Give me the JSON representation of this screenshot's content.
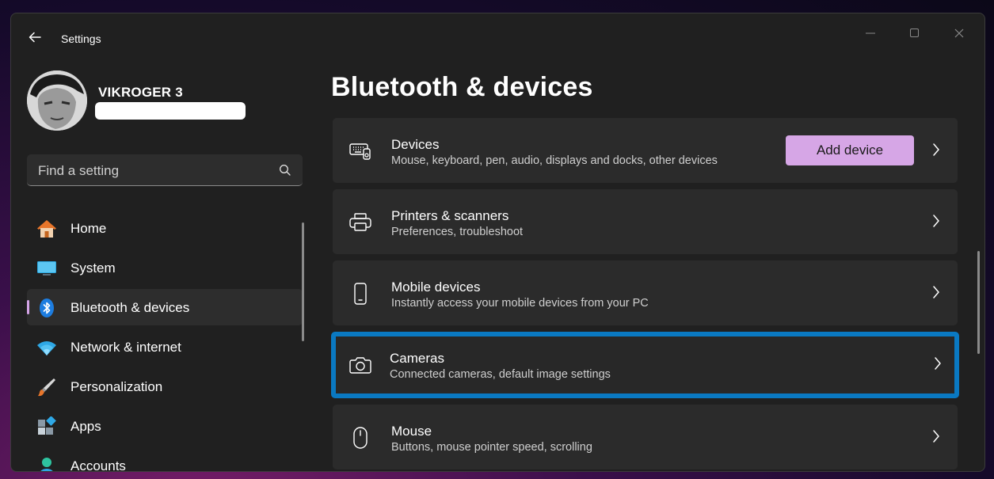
{
  "window": {
    "title": "Settings"
  },
  "profile": {
    "name": "VIKROGER 3"
  },
  "search": {
    "placeholder": "Find a setting"
  },
  "nav": {
    "items": [
      {
        "label": "Home",
        "icon": "home-icon"
      },
      {
        "label": "System",
        "icon": "system-icon"
      },
      {
        "label": "Bluetooth & devices",
        "icon": "bluetooth-icon",
        "active": true
      },
      {
        "label": "Network & internet",
        "icon": "wifi-icon"
      },
      {
        "label": "Personalization",
        "icon": "brush-icon"
      },
      {
        "label": "Apps",
        "icon": "apps-icon"
      },
      {
        "label": "Accounts",
        "icon": "accounts-icon"
      }
    ]
  },
  "page": {
    "title": "Bluetooth & devices"
  },
  "cards": [
    {
      "title": "Devices",
      "subtitle": "Mouse, keyboard, pen, audio, displays and docks, other devices",
      "icon": "devices-icon",
      "button": "Add device"
    },
    {
      "title": "Printers & scanners",
      "subtitle": "Preferences, troubleshoot",
      "icon": "printer-icon"
    },
    {
      "title": "Mobile devices",
      "subtitle": "Instantly access your mobile devices from your PC",
      "icon": "phone-icon"
    },
    {
      "title": "Cameras",
      "subtitle": "Connected cameras, default image settings",
      "icon": "camera-icon",
      "highlighted": true
    },
    {
      "title": "Mouse",
      "subtitle": "Buttons, mouse pointer speed, scrolling",
      "icon": "mouse-icon"
    }
  ],
  "colors": {
    "accent": "#d6a6e6",
    "highlight": "#0a79c2",
    "window_bg": "#202020",
    "card_bg": "#2b2b2b"
  }
}
